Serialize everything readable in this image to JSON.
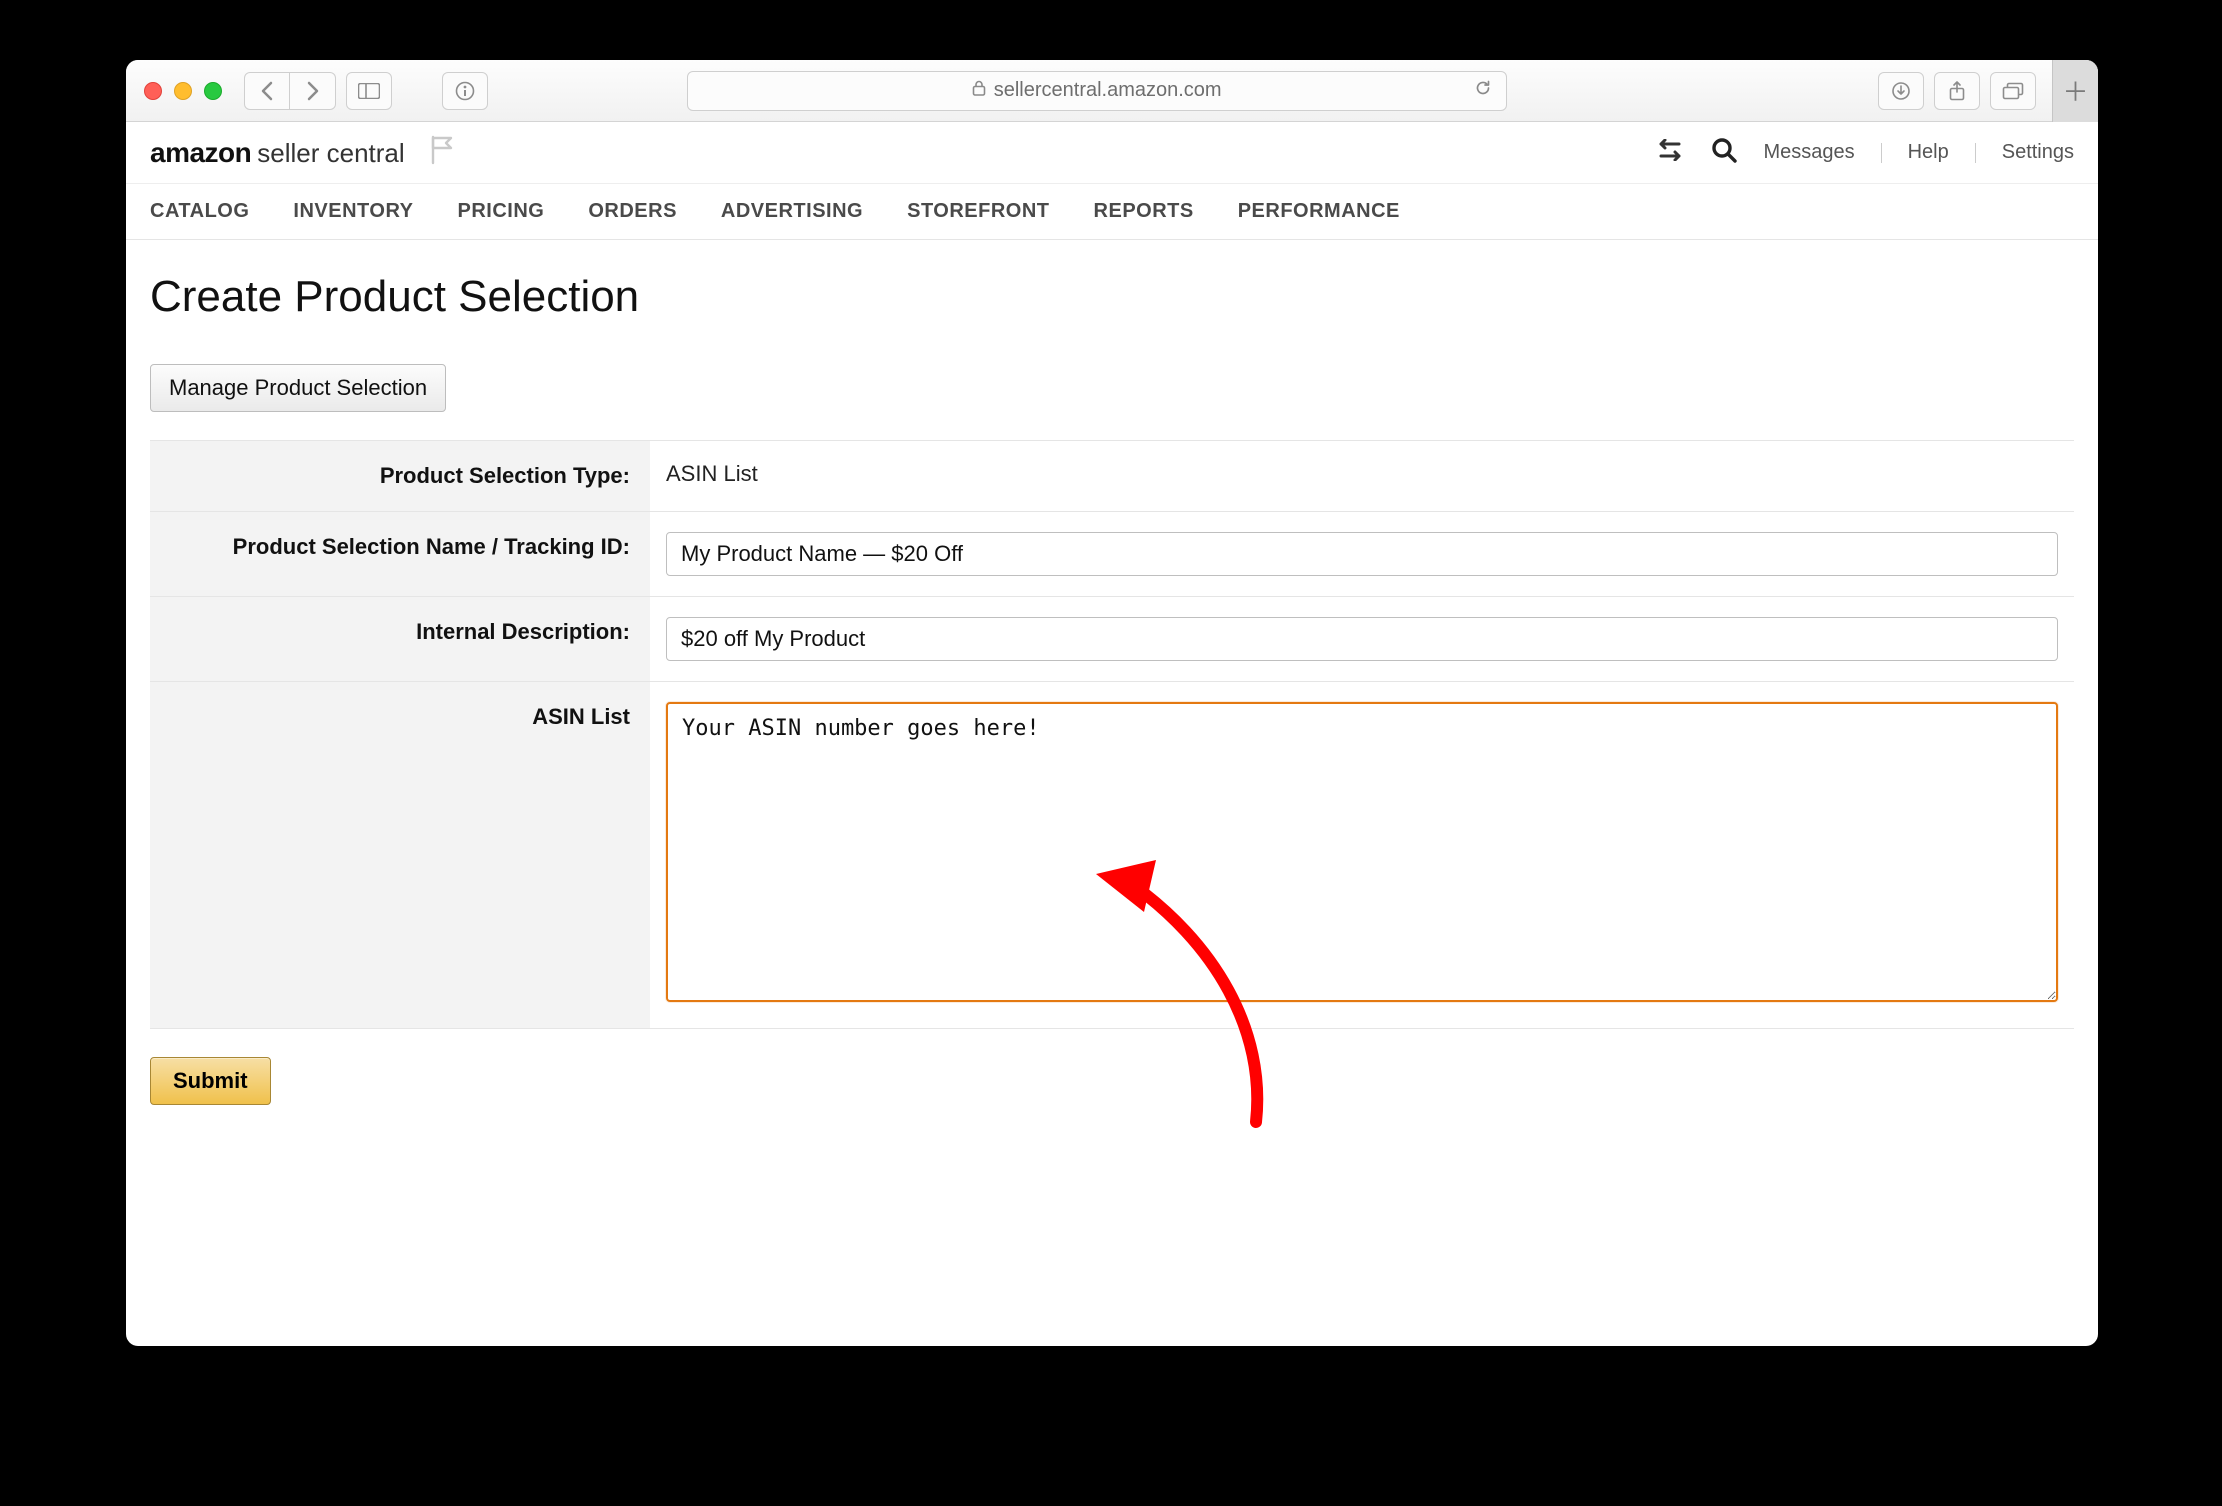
{
  "browser": {
    "url_host": "sellercentral.amazon.com"
  },
  "header": {
    "logo_brand": "amazon",
    "logo_sub": "seller central",
    "links": {
      "messages": "Messages",
      "help": "Help",
      "settings": "Settings"
    }
  },
  "nav": {
    "items": [
      "CATALOG",
      "INVENTORY",
      "PRICING",
      "ORDERS",
      "ADVERTISING",
      "STOREFRONT",
      "REPORTS",
      "PERFORMANCE"
    ]
  },
  "page": {
    "title": "Create Product Selection",
    "manage_button": "Manage Product Selection",
    "rows": {
      "type": {
        "label": "Product Selection Type:",
        "value": "ASIN List"
      },
      "name": {
        "label": "Product Selection Name / Tracking ID:",
        "value": "My Product Name — $20 Off"
      },
      "desc": {
        "label": "Internal Description:",
        "value": "$20 off My Product"
      },
      "asin": {
        "label": "ASIN List",
        "value": "Your ASIN number goes here!"
      }
    },
    "submit": "Submit"
  }
}
